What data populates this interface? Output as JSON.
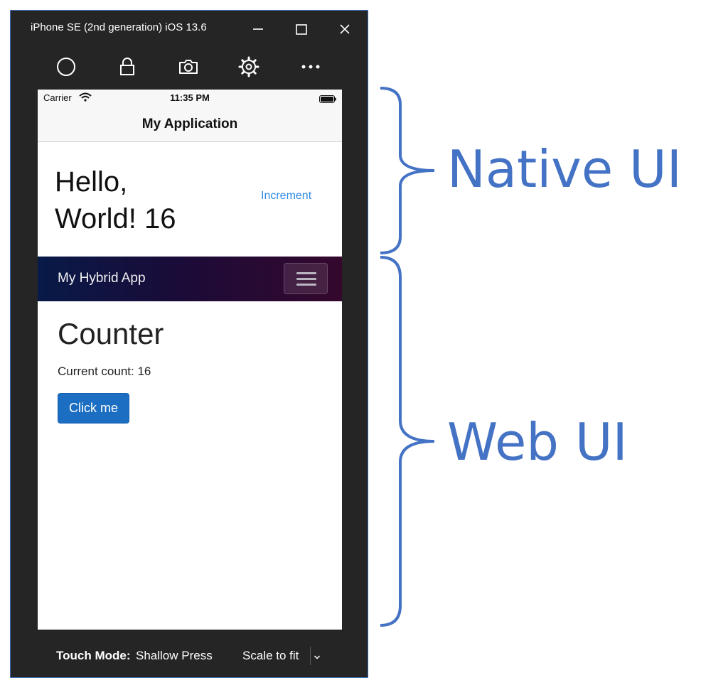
{
  "window": {
    "title": "iPhone SE (2nd generation) iOS 13.6",
    "controls": [
      "minimize-icon",
      "maximize-icon",
      "close-icon"
    ],
    "frame_color": "#3f6fb6",
    "background_color": "#252525"
  },
  "toolbar": {
    "icons": [
      "home-icon",
      "lock-icon",
      "camera-icon",
      "gear-icon",
      "more-icon"
    ]
  },
  "device": {
    "statusbar": {
      "carrier": "Carrier",
      "time": "11:35 PM"
    },
    "navbar": {
      "title": "My Application"
    },
    "native": {
      "greeting_line1": "Hello,",
      "greeting_line2": "World! 16",
      "increment_label": "Increment",
      "link_color": "#2f8ae6"
    },
    "web": {
      "brand": "My Hybrid App",
      "heading": "Counter",
      "count_text": "Current count: 16",
      "button_label": "Click me",
      "button_color": "#1b6ec2"
    }
  },
  "bottombar": {
    "touch_mode_label": "Touch Mode:",
    "touch_mode_value": "Shallow Press",
    "scale_value": "Scale to fit"
  },
  "annotations": {
    "native_label": "Native UI",
    "web_label": "Web UI",
    "color": "#4472c4"
  }
}
